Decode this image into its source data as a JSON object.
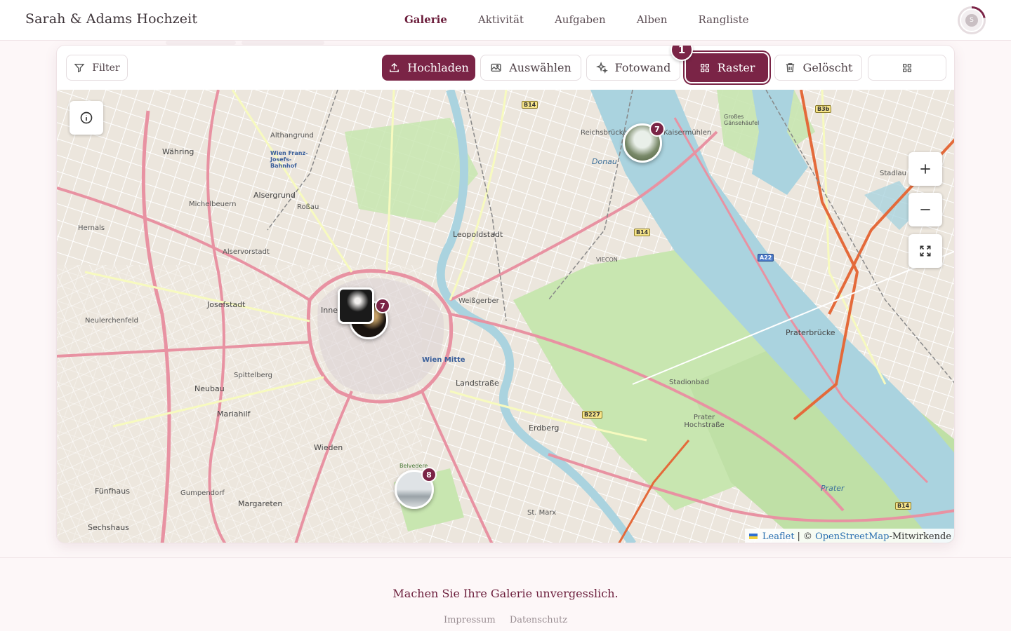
{
  "app": {
    "title": "Sarah & Adams Hochzeit"
  },
  "nav": {
    "items": [
      {
        "label": "Galerie",
        "active": true
      },
      {
        "label": "Aktivität",
        "active": false
      },
      {
        "label": "Aufgaben",
        "active": false
      },
      {
        "label": "Alben",
        "active": false
      },
      {
        "label": "Rangliste",
        "active": false
      }
    ],
    "avatar_initial": "S"
  },
  "toolbar": {
    "filter_label": "Filter",
    "upload_label": "Hochladen",
    "select_label": "Auswählen",
    "photowall_label": "Fotowand",
    "grid_label": "Raster",
    "deleted_label": "Gelöscht",
    "step_badge": "1"
  },
  "map": {
    "clusters": [
      {
        "name": "cluster-donau",
        "count": "7"
      },
      {
        "name": "cluster-innere-stadt",
        "count": "7"
      },
      {
        "name": "cluster-belvedere",
        "count": "8"
      }
    ],
    "labels": {
      "leopoldstadt": "Leopoldstadt",
      "alsergrund": "Alsergrund",
      "josefstadt": "Josefstadt",
      "neubau": "Neubau",
      "mariahilf": "Mariahilf",
      "wieden": "Wieden",
      "margareten": "Margareten",
      "landstrasse": "Landstraße",
      "erdberg": "Erdberg",
      "weissgerber": "Weißgerber",
      "waehring": "Währing",
      "hernals": "Hernals",
      "michelbeuern": "Michelbeuern",
      "alservorstadt": "Alservorstadt",
      "neulerchenfeld": "Neulerchenfeld",
      "althangrund": "Althangrund",
      "rossau": "Roßau",
      "spittelberg": "Spittelberg",
      "gumpendorf": "Gumpendorf",
      "fuenfhaus": "Fünfhaus",
      "sechshaus": "Sechshaus",
      "innere": "Inne",
      "donau": "Donau",
      "praterbruecke": "Praterbrücke",
      "prater": "Prater",
      "reichsbruecke": "Reichsbrücke",
      "stadlau": "Stadlau",
      "kaisermuehlen": "Kaisermühlen",
      "wien_mitte": "Wien Mitte",
      "st_marx": "St. Marx",
      "stadionbad": "Stadionbad",
      "praterhochstrasse": "Prater Hochstraße",
      "grosses_gaensehaeufel": "Großes Gänsehäufel",
      "viecon": "VIECON",
      "belvedere": "Belvedere",
      "franz_josefs": "Wien Franz-Josefs-Bahnhof",
      "b14": "B14",
      "b227": "B227",
      "b3b": "B3b",
      "a22": "A22"
    },
    "attribution": {
      "leaflet": "Leaflet",
      "separator": "| ©",
      "osm": "OpenStreetMap",
      "suffix": "-Mitwirkende"
    }
  },
  "footer": {
    "tagline": "Machen Sie Ihre Galerie unvergesslich.",
    "imprint": "Impressum",
    "privacy": "Datenschutz"
  },
  "colors": {
    "accent": "#7a2446",
    "water": "#aad3df",
    "park": "#c8e6b0",
    "road_major": "#e892a2",
    "road_secondary": "#f7fabf"
  }
}
